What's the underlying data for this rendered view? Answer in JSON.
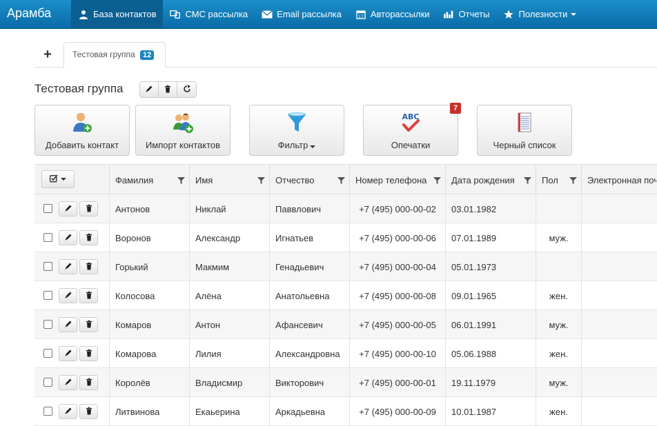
{
  "navbar": {
    "brand": "Арамба",
    "items": [
      {
        "label": "База контактов",
        "icon": "user-icon",
        "active": true
      },
      {
        "label": "СМС рассылка",
        "icon": "sms-icon"
      },
      {
        "label": "Email рассылка",
        "icon": "envelope-icon"
      },
      {
        "label": "Авторассылки",
        "icon": "calendar-icon"
      },
      {
        "label": "Отчеты",
        "icon": "bar-chart-icon"
      },
      {
        "label": "Полезности",
        "icon": "star-icon"
      }
    ]
  },
  "tabs": {
    "add_label": "+",
    "active": {
      "label": "Тестовая группа",
      "count": "12"
    }
  },
  "group": {
    "title": "Тестовая группа"
  },
  "actions": [
    {
      "label": "Добавить контакт",
      "icon": "add-contact-icon"
    },
    {
      "label": "Импорт контактов",
      "icon": "import-contacts-icon"
    },
    {
      "label": "Фильтр",
      "icon": "filter-icon"
    },
    {
      "label": "Опечатки",
      "icon": "spellcheck-icon",
      "badge": "7"
    },
    {
      "label": "Черный список",
      "icon": "notepad-icon"
    }
  ],
  "colors": {
    "navbar": "#0a6ca8",
    "accent": "#1a87c2",
    "badge_red": "#c9302c"
  },
  "table": {
    "columns": [
      "Фамилия",
      "Имя",
      "Отчество",
      "Номер телефона",
      "Дата рождения",
      "Пол",
      "Электронная почта"
    ],
    "rows": [
      {
        "last": "Антонов",
        "first": "Никлай",
        "middle": "Паввлович",
        "phone": "+7 (495) 000-00-02",
        "birth": "03.01.1982",
        "gender": ""
      },
      {
        "last": "Воронов",
        "first": "Александр",
        "middle": "Игнатьев",
        "phone": "+7 (495) 000-00-06",
        "birth": "07.01.1989",
        "gender": "муж."
      },
      {
        "last": "Горький",
        "first": "Макмим",
        "middle": "Генадьевич",
        "phone": "+7 (495) 000-00-04",
        "birth": "05.01.1973",
        "gender": ""
      },
      {
        "last": "Колосова",
        "first": "Алёна",
        "middle": "Анатольевна",
        "phone": "+7 (495) 000-00-08",
        "birth": "09.01.1965",
        "gender": "жен."
      },
      {
        "last": "Комаров",
        "first": "Антон",
        "middle": "Афансевич",
        "phone": "+7 (495) 000-00-05",
        "birth": "06.01.1991",
        "gender": "муж."
      },
      {
        "last": "Комарова",
        "first": "Лилия",
        "middle": "Александровна",
        "phone": "+7 (495) 000-00-10",
        "birth": "05.06.1988",
        "gender": "жен."
      },
      {
        "last": "Королёв",
        "first": "Владисмир",
        "middle": "Викторович",
        "phone": "+7 (495) 000-00-01",
        "birth": "19.11.1979",
        "gender": "муж."
      },
      {
        "last": "Литвинова",
        "first": "Екаьерина",
        "middle": "Аркадьевна",
        "phone": "+7 (495) 000-00-09",
        "birth": "10.01.1987",
        "gender": "жен."
      }
    ]
  }
}
